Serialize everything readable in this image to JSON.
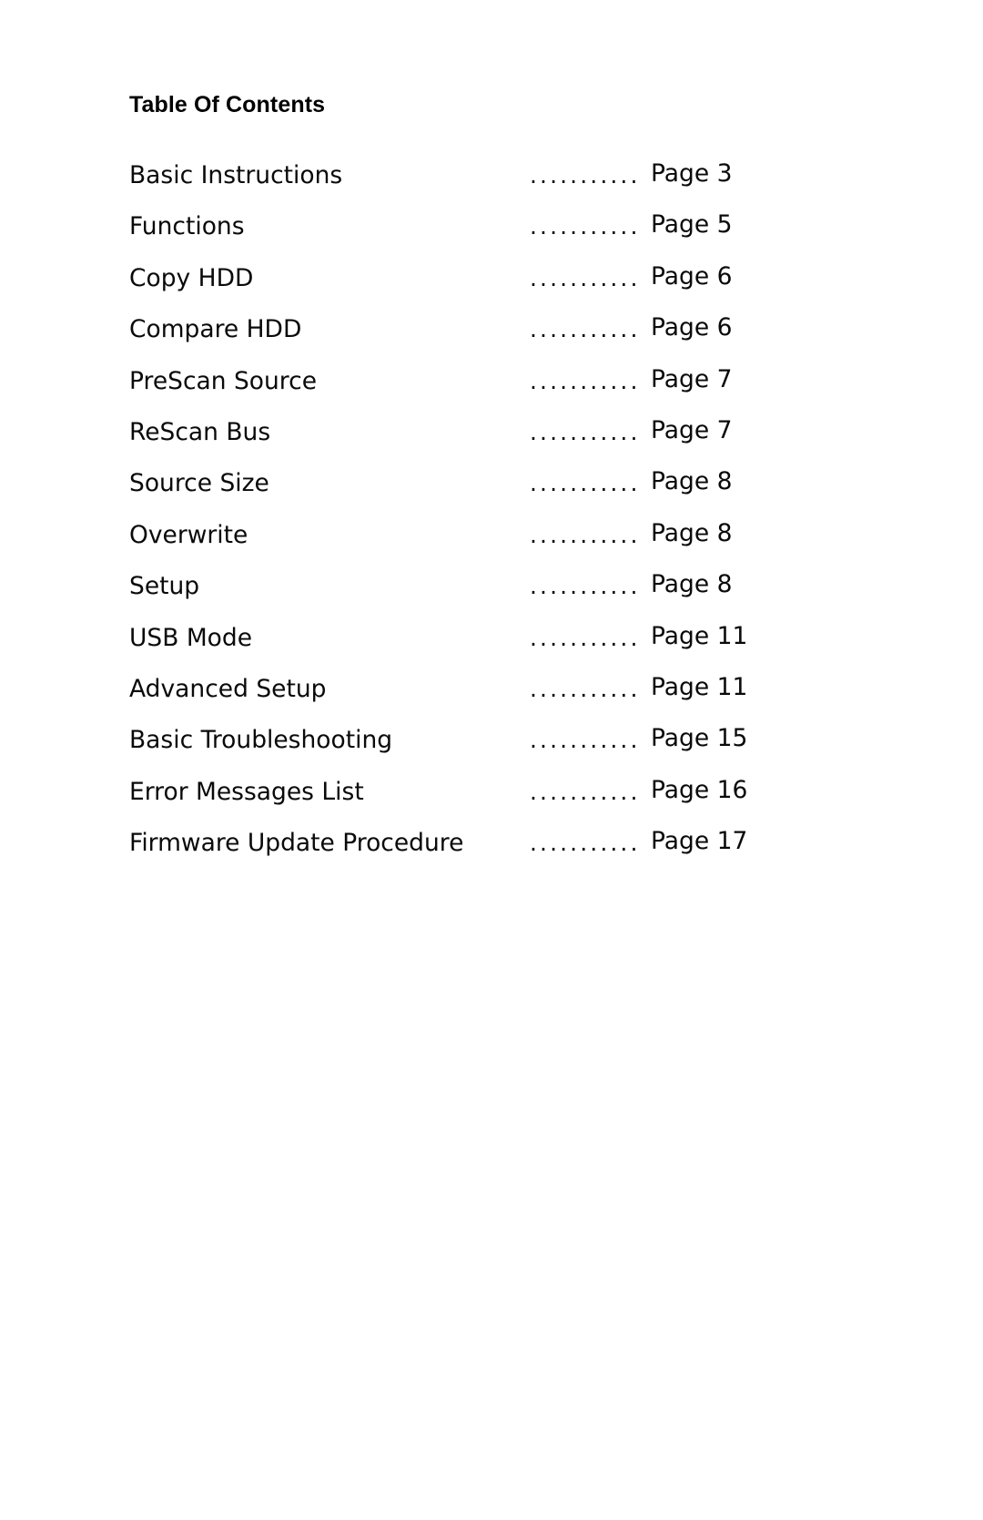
{
  "document": {
    "title": "Table Of Contents",
    "page_label_prefix": "Page",
    "leader_dots": "•••••••••••••",
    "leader_glyph": ". . . . . . . . . . . . .",
    "background_color": "#ffffff",
    "text_color": "#0a0a0a"
  },
  "toc": {
    "entries": [
      {
        "label": "Basic Instructions",
        "leader": "............",
        "page": "Page 3"
      },
      {
        "label": "Functions",
        "leader": "............",
        "page": "Page 5"
      },
      {
        "label": "Copy HDD",
        "leader": "............",
        "page": "Page 6"
      },
      {
        "label": "Compare HDD",
        "leader": "............",
        "page": "Page 6"
      },
      {
        "label": "PreScan Source",
        "leader": "............",
        "page": "Page 7"
      },
      {
        "label": "ReScan Bus",
        "leader": "............",
        "page": "Page 7"
      },
      {
        "label": "Source Size",
        "leader": "............",
        "page": "Page 8"
      },
      {
        "label": "Overwrite",
        "leader": "............",
        "page": "Page 8"
      },
      {
        "label": "Setup",
        "leader": "............",
        "page": "Page 8"
      },
      {
        "label": "USB Mode",
        "leader": "............",
        "page": "Page 11"
      },
      {
        "label": "Advanced Setup",
        "leader": "............",
        "page": "Page 11"
      },
      {
        "label": "Basic Troubleshooting",
        "leader": "............",
        "page": "Page 15"
      },
      {
        "label": "Error Messages List",
        "leader": "............",
        "page": "Page 16"
      },
      {
        "label": "Firmware Update Procedure",
        "leader": "............",
        "page": "Page 17"
      }
    ]
  }
}
